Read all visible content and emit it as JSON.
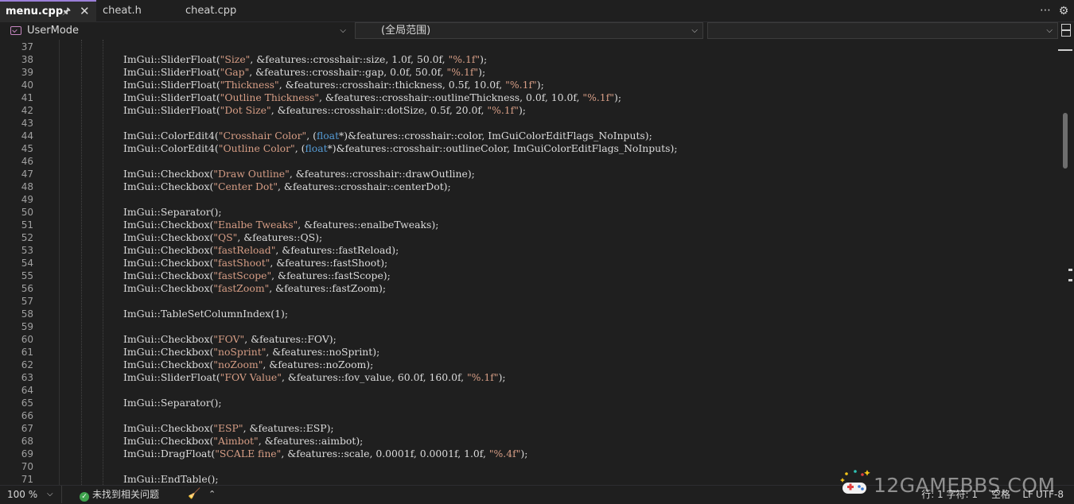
{
  "tabs": [
    {
      "label": "menu.cpp",
      "active": true,
      "pinned": true
    },
    {
      "label": "cheat.h",
      "active": false
    },
    {
      "label": "cheat.cpp",
      "active": false
    }
  ],
  "tabbar": {
    "more_icon": "ellipsis-icon",
    "settings_icon": "gear-icon"
  },
  "navbar": {
    "project": "UserMode",
    "scope": "(全局范围)",
    "member": ""
  },
  "editor": {
    "lines": [
      {
        "n": "37",
        "code": []
      },
      {
        "n": "38",
        "code": [
          [
            "ns",
            "ImGui::SliderFloat("
          ],
          [
            "str",
            "\"Size\""
          ],
          [
            "ns",
            ", &features::crosshair::size, 1.0f, 50.0f, "
          ],
          [
            "str",
            "\"%.1f\""
          ],
          [
            "ns",
            ");"
          ]
        ]
      },
      {
        "n": "39",
        "code": [
          [
            "ns",
            "ImGui::SliderFloat("
          ],
          [
            "str",
            "\"Gap\""
          ],
          [
            "ns",
            ", &features::crosshair::gap, 0.0f, 50.0f, "
          ],
          [
            "str",
            "\"%.1f\""
          ],
          [
            "ns",
            ");"
          ]
        ]
      },
      {
        "n": "40",
        "code": [
          [
            "ns",
            "ImGui::SliderFloat("
          ],
          [
            "str",
            "\"Thickness\""
          ],
          [
            "ns",
            ", &features::crosshair::thickness, 0.5f, 10.0f, "
          ],
          [
            "str",
            "\"%.1f\""
          ],
          [
            "ns",
            ");"
          ]
        ]
      },
      {
        "n": "41",
        "code": [
          [
            "ns",
            "ImGui::SliderFloat("
          ],
          [
            "str",
            "\"Outline Thickness\""
          ],
          [
            "ns",
            ", &features::crosshair::outlineThickness, 0.0f, 10.0f, "
          ],
          [
            "str",
            "\"%.1f\""
          ],
          [
            "ns",
            ");"
          ]
        ]
      },
      {
        "n": "42",
        "code": [
          [
            "ns",
            "ImGui::SliderFloat("
          ],
          [
            "str",
            "\"Dot Size\""
          ],
          [
            "ns",
            ", &features::crosshair::dotSize, 0.5f, 20.0f, "
          ],
          [
            "str",
            "\"%.1f\""
          ],
          [
            "ns",
            ");"
          ]
        ]
      },
      {
        "n": "43",
        "code": []
      },
      {
        "n": "44",
        "code": [
          [
            "ns",
            "ImGui::ColorEdit4("
          ],
          [
            "str",
            "\"Crosshair Color\""
          ],
          [
            "ns",
            ", ("
          ],
          [
            "kw",
            "float"
          ],
          [
            "ns",
            "*)&features::crosshair::color, ImGuiColorEditFlags_NoInputs);"
          ]
        ]
      },
      {
        "n": "45",
        "code": [
          [
            "ns",
            "ImGui::ColorEdit4("
          ],
          [
            "str",
            "\"Outline Color\""
          ],
          [
            "ns",
            ", ("
          ],
          [
            "kw",
            "float"
          ],
          [
            "ns",
            "*)&features::crosshair::outlineColor, ImGuiColorEditFlags_NoInputs);"
          ]
        ]
      },
      {
        "n": "46",
        "code": []
      },
      {
        "n": "47",
        "code": [
          [
            "ns",
            "ImGui::Checkbox("
          ],
          [
            "str",
            "\"Draw Outline\""
          ],
          [
            "ns",
            ", &features::crosshair::drawOutline);"
          ]
        ]
      },
      {
        "n": "48",
        "code": [
          [
            "ns",
            "ImGui::Checkbox("
          ],
          [
            "str",
            "\"Center Dot\""
          ],
          [
            "ns",
            ", &features::crosshair::centerDot);"
          ]
        ]
      },
      {
        "n": "49",
        "code": []
      },
      {
        "n": "50",
        "code": [
          [
            "ns",
            "ImGui::Separator();"
          ]
        ]
      },
      {
        "n": "51",
        "code": [
          [
            "ns",
            "ImGui::Checkbox("
          ],
          [
            "str",
            "\"Enalbe Tweaks\""
          ],
          [
            "ns",
            ", &features::enalbeTweaks);"
          ]
        ]
      },
      {
        "n": "52",
        "code": [
          [
            "ns",
            "ImGui::Checkbox("
          ],
          [
            "str",
            "\"QS\""
          ],
          [
            "ns",
            ", &features::QS);"
          ]
        ]
      },
      {
        "n": "53",
        "code": [
          [
            "ns",
            "ImGui::Checkbox("
          ],
          [
            "str",
            "\"fastReload\""
          ],
          [
            "ns",
            ", &features::fastReload);"
          ]
        ]
      },
      {
        "n": "54",
        "code": [
          [
            "ns",
            "ImGui::Checkbox("
          ],
          [
            "str",
            "\"fastShoot\""
          ],
          [
            "ns",
            ", &features::fastShoot);"
          ]
        ]
      },
      {
        "n": "55",
        "code": [
          [
            "ns",
            "ImGui::Checkbox("
          ],
          [
            "str",
            "\"fastScope\""
          ],
          [
            "ns",
            ", &features::fastScope);"
          ]
        ]
      },
      {
        "n": "56",
        "code": [
          [
            "ns",
            "ImGui::Checkbox("
          ],
          [
            "str",
            "\"fastZoom\""
          ],
          [
            "ns",
            ", &features::fastZoom);"
          ]
        ]
      },
      {
        "n": "57",
        "code": []
      },
      {
        "n": "58",
        "code": [
          [
            "ns",
            "ImGui::TableSetColumnIndex(1);"
          ]
        ]
      },
      {
        "n": "59",
        "code": []
      },
      {
        "n": "60",
        "code": [
          [
            "ns",
            "ImGui::Checkbox("
          ],
          [
            "str",
            "\"FOV\""
          ],
          [
            "ns",
            ", &features::FOV);"
          ]
        ]
      },
      {
        "n": "61",
        "code": [
          [
            "ns",
            "ImGui::Checkbox("
          ],
          [
            "str",
            "\"noSprint\""
          ],
          [
            "ns",
            ", &features::noSprint);"
          ]
        ]
      },
      {
        "n": "62",
        "code": [
          [
            "ns",
            "ImGui::Checkbox("
          ],
          [
            "str",
            "\"noZoom\""
          ],
          [
            "ns",
            ", &features::noZoom);"
          ]
        ]
      },
      {
        "n": "63",
        "code": [
          [
            "ns",
            "ImGui::SliderFloat("
          ],
          [
            "str",
            "\"FOV Value\""
          ],
          [
            "ns",
            ", &features::fov_value, 60.0f, 160.0f, "
          ],
          [
            "str",
            "\"%.1f\""
          ],
          [
            "ns",
            ");"
          ]
        ]
      },
      {
        "n": "64",
        "code": []
      },
      {
        "n": "65",
        "code": [
          [
            "ns",
            "ImGui::Separator();"
          ]
        ]
      },
      {
        "n": "66",
        "code": []
      },
      {
        "n": "67",
        "code": [
          [
            "ns",
            "ImGui::Checkbox("
          ],
          [
            "str",
            "\"ESP\""
          ],
          [
            "ns",
            ", &features::ESP);"
          ]
        ]
      },
      {
        "n": "68",
        "code": [
          [
            "ns",
            "ImGui::Checkbox("
          ],
          [
            "str",
            "\"Aimbot\""
          ],
          [
            "ns",
            ", &features::aimbot);"
          ]
        ]
      },
      {
        "n": "69",
        "code": [
          [
            "ns",
            "ImGui::DragFloat("
          ],
          [
            "str",
            "\"SCALE fine\""
          ],
          [
            "ns",
            ", &features::scale, 0.0001f, 0.0001f, 1.0f, "
          ],
          [
            "str",
            "\"%.4f\""
          ],
          [
            "ns",
            ");"
          ]
        ]
      },
      {
        "n": "70",
        "code": []
      },
      {
        "n": "71",
        "code": [
          [
            "ns",
            "ImGui::EndTable();"
          ]
        ]
      }
    ]
  },
  "status": {
    "zoom": "100 %",
    "issues": "未找到相关问题",
    "position": "行: 1  字符: 1",
    "whitespace": "空格",
    "line_ending": "LF",
    "encoding": "UTF-8",
    "watermark": "12GAMEBBS.COM"
  },
  "colors": {
    "background": "#1f1f1f",
    "string": "#d69d85",
    "keyword": "#569cd6",
    "text": "#dcdcdc",
    "active_tab_accent": "#9b7fd8",
    "ok_badge": "#3fa34d"
  }
}
